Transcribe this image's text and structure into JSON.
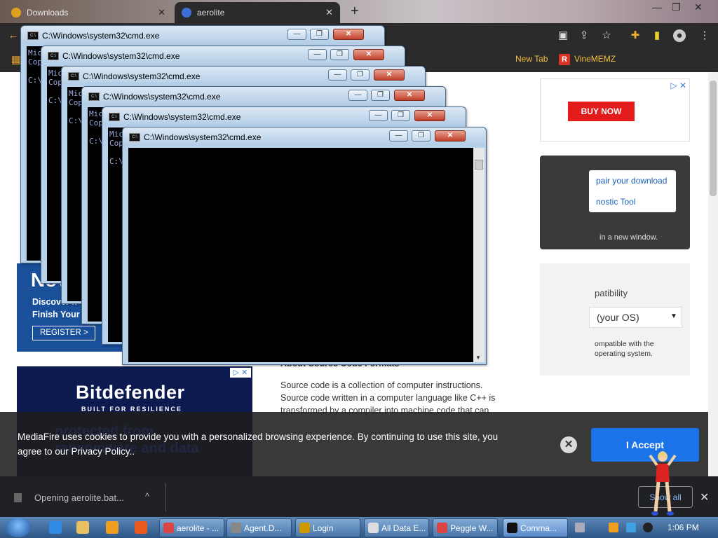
{
  "browser": {
    "tabs": [
      {
        "label": "Downloads",
        "close": "✕"
      },
      {
        "label": "aerolite",
        "close": "✕"
      }
    ],
    "new_tab": "+",
    "window_controls": {
      "minimize": "—",
      "maximize": "❐",
      "close": "✕"
    },
    "bookmarks": [
      {
        "label": "New Tab"
      },
      {
        "label": "VineMEMZ",
        "icon_letter": "R"
      }
    ]
  },
  "page": {
    "ads": {
      "buy_now": "BUY NOW",
      "repair_download": "pair your download",
      "diagnostic_tool": "nostic Tool",
      "new_window": "in a new window.",
      "register_big": "Nov",
      "register_lines": [
        "Discover n",
        "Finish Your"
      ],
      "register_button": "REGISTER >",
      "bitdefender_logo": "Bitdefender",
      "bitdefender_tagline": "BUILT FOR RESILIENCE",
      "bitdefender_ghost": "protected from ransomware and data",
      "adchoices": "▷ ✕"
    },
    "compat": {
      "title": "patibility",
      "os_select": "(your OS)",
      "note": "ompatible with the operating system."
    },
    "about": {
      "heading": "About Source Code Formats",
      "paragraph": "Source code is a collection of computer instructions. Source code written in a computer language like C++ is transformed by a compiler into machine code that can"
    }
  },
  "cookie": {
    "text": "MediaFire uses cookies to provide you with a personalized browsing experience. By continuing to use this site, you agree to our Privacy Policy..",
    "close": "✕",
    "accept": "I Accept"
  },
  "download_bar": {
    "item": "Opening aerolite.bat...",
    "chevron": "^",
    "show_all": "Show all",
    "close": "✕"
  },
  "cmd_windows": {
    "title": "C:\\Windows\\system32\\cmd.exe",
    "peek_text": [
      "Mic",
      "Cop",
      "",
      "C:\\"
    ],
    "button_min": "—",
    "button_max": "❐",
    "button_close": "✕",
    "scroll_down": "▼"
  },
  "taskbar": {
    "buttons": [
      {
        "label": "aerolite - ..."
      },
      {
        "label": "Agent.D..."
      },
      {
        "label": "Login"
      },
      {
        "label": "All Data E..."
      },
      {
        "label": "Peggle W..."
      },
      {
        "label": "Comma..."
      }
    ],
    "clock": "1:06 PM"
  },
  "colors": {
    "accent_blue": "#1a73e8",
    "buy_now_red": "#e31b1b",
    "cmd_frame": "#b8d1ea"
  }
}
